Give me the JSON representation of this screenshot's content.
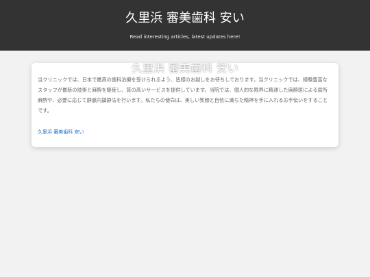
{
  "header": {
    "title": "久里浜 審美歯科 安い",
    "tagline": "Read interesting articles, latest updates here!"
  },
  "card": {
    "heading": "久里浜 審美歯科 安い",
    "body": "当クリニックでは、日本で最高の歯科治療を受けられるよう、皆様のお越しをお待ちしております。当クリニックでは、経験豊富なスタッフが最新の技術と麻酔を駆使し、質の高いサービスを提供しています。当院では、個人的な限界に精通した麻酔医による局所麻酔や、必要に応じて静脈内鎮静法を行います。私たちの使命は、美しい笑顔と自信に満ちた精神を手に入れるお手伝いをすることです。",
    "link": "久里浜 審美歯科 安い"
  },
  "colors": {
    "header_bg": "#333333",
    "page_bg": "#f2f2f2",
    "link": "#1e6fd0"
  }
}
